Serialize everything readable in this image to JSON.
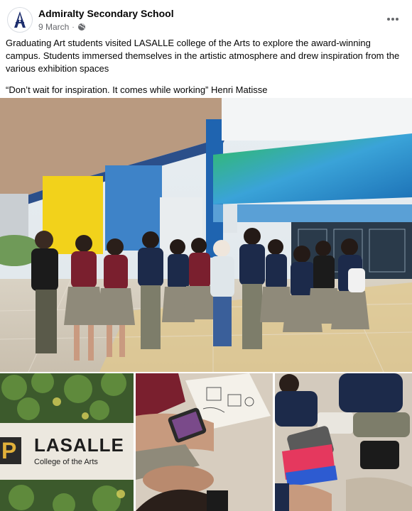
{
  "post": {
    "page_name": "Admiralty Secondary School",
    "date": "9 March",
    "separator": "·",
    "audience_icon": "globe-icon",
    "more_icon": "more-horizontal-icon",
    "text_paragraph_1": "Graduating Art students visited LASALLE college of the Arts to explore the award-winning campus. Students immersed themselves in the artistic atmosphere and drew inspiration from the various exhibition spaces",
    "text_paragraph_2": "“Don’t wait for inspiration. It comes while working” Henri Matisse"
  },
  "photos": {
    "sign_title": "LASALLE",
    "sign_subtitle": "College of the Arts",
    "sign_letter": "P"
  },
  "colors": {
    "text_primary": "#050505",
    "text_secondary": "#65676b",
    "accent_yellow": "#f2d21b",
    "accent_blue": "#1f64b0",
    "uniform_maroon": "#7a1f2e",
    "uniform_navy": "#1c2a4a"
  }
}
